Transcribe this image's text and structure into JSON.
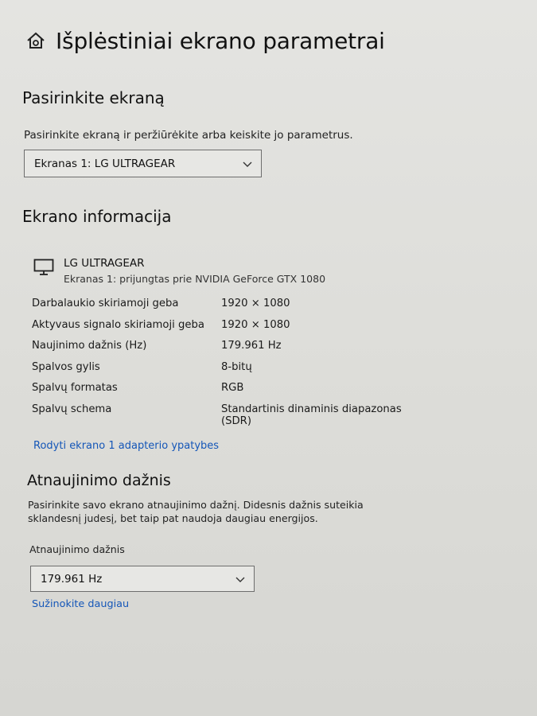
{
  "header": {
    "title": "Išplėstiniai ekrano parametrai",
    "icon": "home-gear-icon"
  },
  "select_display": {
    "heading": "Pasirinkite ekraną",
    "description": "Pasirinkite ekraną ir peržiūrėkite arba keiskite jo parametrus.",
    "selected": "Ekranas 1: LG ULTRAGEAR"
  },
  "display_info": {
    "heading": "Ekrano informacija",
    "monitor_name": "LG ULTRAGEAR",
    "monitor_sub": "Ekranas 1: prijungtas prie NVIDIA GeForce GTX 1080",
    "rows": [
      {
        "label": "Darbalaukio skiriamoji geba",
        "value": "1920 × 1080"
      },
      {
        "label": "Aktyvaus signalo skiriamoji geba",
        "value": "1920 × 1080"
      },
      {
        "label": "Naujinimo dažnis (Hz)",
        "value": "179.961 Hz"
      },
      {
        "label": "Spalvos gylis",
        "value": "8-bitų"
      },
      {
        "label": "Spalvų formatas",
        "value": "RGB"
      },
      {
        "label": "Spalvų schema",
        "value": "Standartinis dinaminis diapazonas (SDR)"
      }
    ],
    "adapter_link": "Rodyti ekrano 1 adapterio ypatybes"
  },
  "refresh": {
    "heading": "Atnaujinimo dažnis",
    "description": "Pasirinkite savo ekrano atnaujinimo dažnį. Didesnis dažnis suteikia sklandesnį judesį, bet taip pat naudoja daugiau energijos.",
    "field_label": "Atnaujinimo dažnis",
    "selected": "179.961 Hz",
    "learn_more": "Sužinokite daugiau"
  },
  "colors": {
    "link": "#1456b8",
    "background": "#e2e2df",
    "border": "#6d6d6d"
  }
}
